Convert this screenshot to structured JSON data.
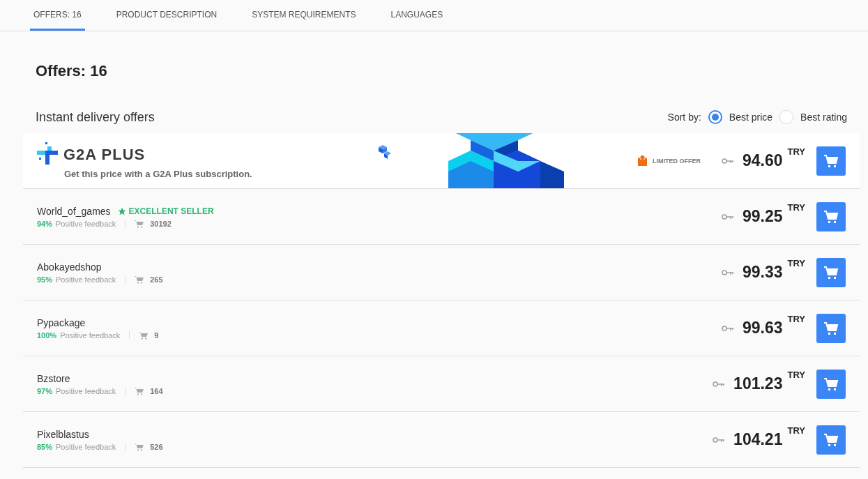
{
  "tabs": [
    {
      "label": "OFFERS: 16",
      "selected": true
    },
    {
      "label": "PRODUCT DESCRIPTION",
      "selected": false
    },
    {
      "label": "SYSTEM REQUIREMENTS",
      "selected": false
    },
    {
      "label": "LANGUAGES",
      "selected": false
    }
  ],
  "heading": "Offers: 16",
  "section_title": "Instant delivery offers",
  "sort": {
    "label": "Sort by:",
    "options": [
      {
        "label": "Best price",
        "selected": true
      },
      {
        "label": "Best rating",
        "selected": false
      }
    ]
  },
  "promo": {
    "logo": "G2A PLUS",
    "subtitle": "Get this price with a G2A Plus subscription.",
    "badge": "LIMITED OFFER",
    "price": "94.60",
    "currency": "TRY"
  },
  "offers": [
    {
      "seller": "World_of_games",
      "badge": "EXCELLENT SELLER",
      "rating": "94%",
      "feedback_label": "Positive feedback",
      "sales": "30192",
      "price": "99.25",
      "currency": "TRY"
    },
    {
      "seller": "Abokayedshop",
      "rating": "95%",
      "feedback_label": "Positive feedback",
      "sales": "265",
      "price": "99.33",
      "currency": "TRY"
    },
    {
      "seller": "Pypackage",
      "rating": "100%",
      "feedback_label": "Positive feedback",
      "sales": "9",
      "price": "99.63",
      "currency": "TRY"
    },
    {
      "seller": "Bzstore",
      "rating": "97%",
      "feedback_label": "Positive feedback",
      "sales": "164",
      "price": "101.23",
      "currency": "TRY"
    },
    {
      "seller": "Pixelblastus",
      "rating": "85%",
      "feedback_label": "Positive feedback",
      "sales": "526",
      "price": "104.21",
      "currency": "TRY"
    }
  ]
}
